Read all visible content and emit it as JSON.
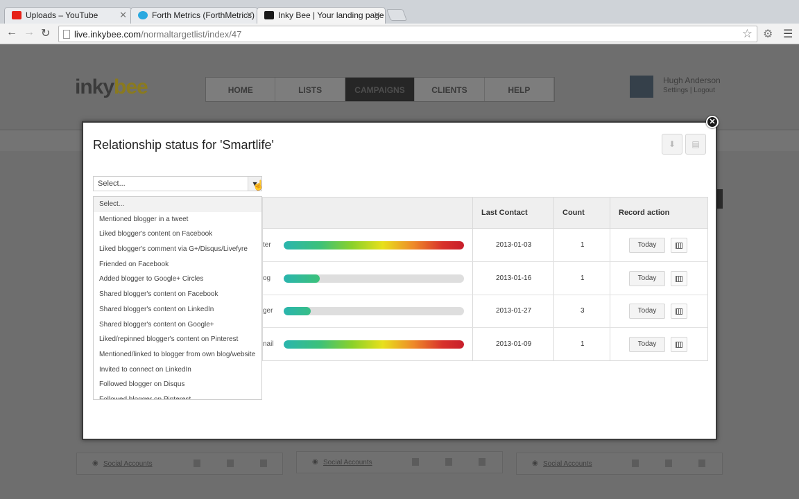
{
  "browser": {
    "tabs": [
      {
        "label": "Uploads – YouTube",
        "color": "#e62117"
      },
      {
        "label": "Forth Metrics (ForthMetrics)",
        "color": "#2aa9e0"
      },
      {
        "label": "Inky Bee | Your landing page",
        "color": "#1a1a1a"
      }
    ],
    "url_host": "live.inkybee.com",
    "url_path": "/normaltargetlist/index/47"
  },
  "site": {
    "logo_left": "inky",
    "logo_right": "bee",
    "nav": [
      "HOME",
      "LISTS",
      "CAMPAIGNS",
      "CLIENTS",
      "HELP"
    ],
    "active_nav": "CAMPAIGNS",
    "user_name": "Hugh Anderson",
    "user_links": "Settings | Logout",
    "social_accounts_label": "Social Accounts"
  },
  "modal": {
    "title": "Relationship status for 'Smartlife'",
    "select_placeholder": "Select...",
    "options": [
      "Select...",
      "Mentioned blogger in a tweet",
      "Liked blogger's content on Facebook",
      "Liked blogger's comment via G+/Disqus/Livefyre",
      "Friended on Facebook",
      "Added blogger to Google+ Circles",
      "Shared blogger's content on Facebook",
      "Shared blogger's content on LinkedIn",
      "Shared blogger's content on Google+",
      "Liked/repinned blogger's content on Pinterest",
      "Mentioned/linked to blogger from own blog/website",
      "Invited to connect on LinkedIn",
      "Followed blogger on Disqus",
      "Followed blogger on Pinterest"
    ],
    "columns": {
      "last_contact": "Last Contact",
      "count": "Count",
      "record_action": "Record action"
    },
    "rows": [
      {
        "label": "ter",
        "progress": 1.0,
        "last_contact": "2013-01-03",
        "count": "1",
        "action": "Today"
      },
      {
        "label": "og",
        "progress": 0.2,
        "last_contact": "2013-01-16",
        "count": "1",
        "action": "Today"
      },
      {
        "label": "ger",
        "progress": 0.15,
        "last_contact": "2013-01-27",
        "count": "3",
        "action": "Today"
      },
      {
        "label": "nail",
        "progress": 1.0,
        "last_contact": "2013-01-09",
        "count": "1",
        "action": "Today"
      }
    ]
  }
}
